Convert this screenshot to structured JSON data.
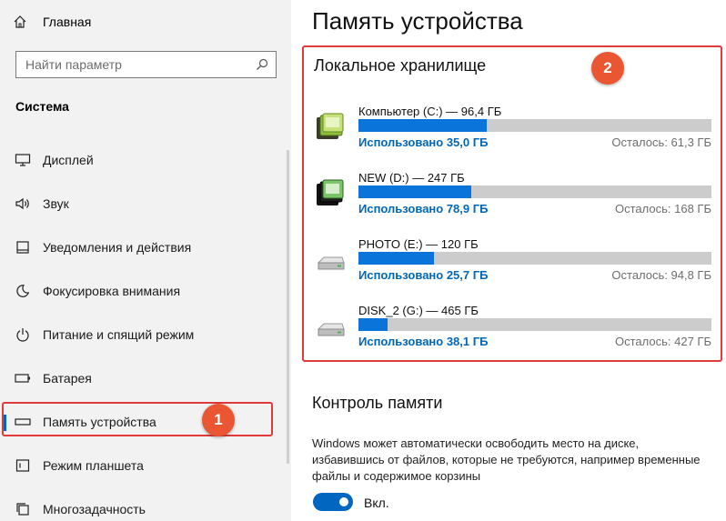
{
  "sidebar": {
    "home_label": "Главная",
    "search_placeholder": "Найти параметр",
    "section_title": "Система",
    "items": [
      {
        "label": "Дисплей",
        "icon": "monitor-icon"
      },
      {
        "label": "Звук",
        "icon": "speaker-icon"
      },
      {
        "label": "Уведомления и действия",
        "icon": "notification-icon"
      },
      {
        "label": "Фокусировка внимания",
        "icon": "moon-icon"
      },
      {
        "label": "Питание и спящий режим",
        "icon": "power-icon"
      },
      {
        "label": "Батарея",
        "icon": "battery-icon"
      },
      {
        "label": "Память устройства",
        "icon": "storage-icon",
        "selected": true
      },
      {
        "label": "Режим планшета",
        "icon": "tablet-icon"
      },
      {
        "label": "Многозадачность",
        "icon": "multitask-icon"
      }
    ]
  },
  "annotations": {
    "badge_1": "1",
    "badge_2": "2",
    "highlight_color": "#e03a3a",
    "badge_color": "#ea5532"
  },
  "main": {
    "title": "Память устройства",
    "storage": {
      "heading": "Локальное хранилище",
      "drives": [
        {
          "name": "Компьютер (C:) — 96,4 ГБ",
          "used": "Использовано 35,0 ГБ",
          "free": "Осталось: 61,3 ГБ",
          "used_fraction": 0.363,
          "icon": "system-drive-icon"
        },
        {
          "name": "NEW (D:) — 247 ГБ",
          "used": "Использовано 78,9 ГБ",
          "free": "Осталось: 168 ГБ",
          "used_fraction": 0.319,
          "icon": "system-drive-icon"
        },
        {
          "name": "PHOTO (E:) — 120 ГБ",
          "used": "Использовано 25,7 ГБ",
          "free": "Осталось: 94,8 ГБ",
          "used_fraction": 0.214,
          "icon": "hard-drive-icon"
        },
        {
          "name": "DISK_2 (G:) — 465 ГБ",
          "used": "Использовано 38,1 ГБ",
          "free": "Осталось: 427 ГБ",
          "used_fraction": 0.082,
          "icon": "hard-drive-icon"
        }
      ]
    },
    "storage_sense": {
      "title": "Контроль памяти",
      "description": "Windows может автоматически освободить место на диске, избавившись от файлов, которые не требуются, например временные файлы и содержимое корзины",
      "toggle_label": "Вкл.",
      "toggle_on": true
    }
  },
  "colors": {
    "accent": "#0067c0",
    "bar_fill": "#0a74da",
    "bar_track": "#cccccc",
    "used_text": "#0067b8"
  }
}
